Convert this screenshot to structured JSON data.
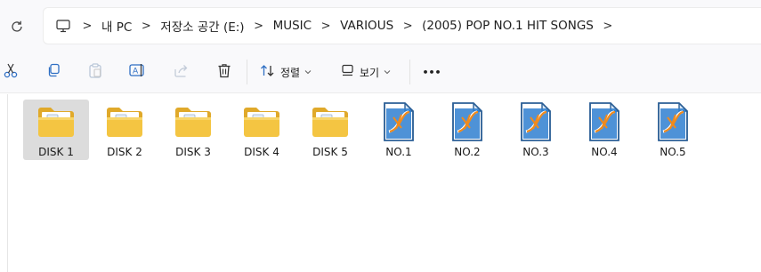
{
  "breadcrumb": {
    "items": [
      "내 PC",
      "저장소 공간 (E:)",
      "MUSIC",
      "VARIOUS",
      "(2005) POP NO.1 HIT SONGS"
    ],
    "separator": ">"
  },
  "toolbar": {
    "sort_label": "정렬",
    "view_label": "보기",
    "more_label": "•••"
  },
  "files": {
    "items": [
      {
        "name": "DISK 1",
        "type": "folder",
        "selected": true
      },
      {
        "name": "DISK 2",
        "type": "folder",
        "selected": false
      },
      {
        "name": "DISK 3",
        "type": "folder",
        "selected": false
      },
      {
        "name": "DISK 4",
        "type": "folder",
        "selected": false
      },
      {
        "name": "DISK 5",
        "type": "folder",
        "selected": false
      },
      {
        "name": "NO.1",
        "type": "playlist-file",
        "selected": false
      },
      {
        "name": "NO.2",
        "type": "playlist-file",
        "selected": false
      },
      {
        "name": "NO.3",
        "type": "playlist-file",
        "selected": false
      },
      {
        "name": "NO.4",
        "type": "playlist-file",
        "selected": false
      },
      {
        "name": "NO.5",
        "type": "playlist-file",
        "selected": false
      }
    ]
  },
  "colors": {
    "folder": "#f4c542",
    "folder_dark": "#e0a92a",
    "file_blue": "#2f7fd0",
    "file_orange": "#f08a1c",
    "selection": "#dcdcdc",
    "icon_accent": "#2f6fc4"
  }
}
